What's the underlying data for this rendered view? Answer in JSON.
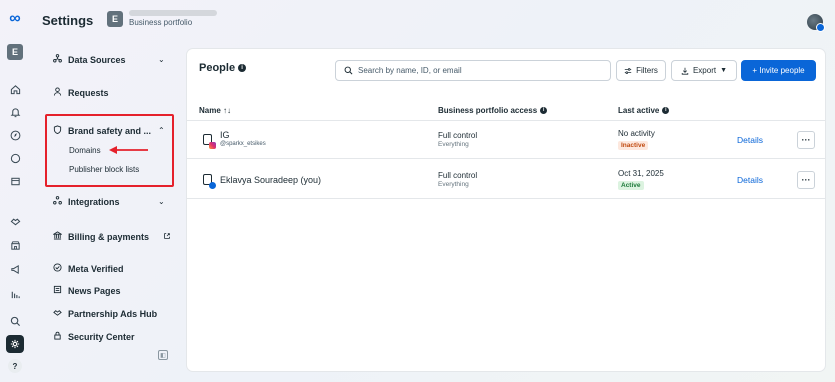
{
  "header": {
    "title": "Settings",
    "account_badge": "E",
    "account_subtitle": "Business portfolio"
  },
  "rail": {
    "e_badge": "E",
    "help": "?"
  },
  "sidebar": {
    "items": [
      {
        "label": "Data Sources",
        "icon": "data-sources-icon"
      },
      {
        "label": "Requests",
        "icon": "people-icon"
      },
      {
        "label": "Brand safety and ...",
        "icon": "shield-icon"
      },
      {
        "label": "Domains"
      },
      {
        "label": "Publisher block lists"
      },
      {
        "label": "Integrations",
        "icon": "integrations-icon"
      },
      {
        "label": "Billing & payments",
        "icon": "bank-icon"
      },
      {
        "label": "Meta Verified",
        "icon": "verified-icon"
      },
      {
        "label": "News Pages",
        "icon": "news-icon"
      },
      {
        "label": "Partnership Ads Hub",
        "icon": "handshake-icon"
      },
      {
        "label": "Security Center",
        "icon": "lock-icon"
      }
    ]
  },
  "people": {
    "title": "People",
    "search_placeholder": "Search by name, ID, or email",
    "filters_label": "Filters",
    "export_label": "Export",
    "invite_label": "+ Invite people",
    "columns": {
      "name": "Name ↑↓",
      "access": "Business portfolio access",
      "last_active": "Last active"
    },
    "rows": [
      {
        "name": "IG",
        "handle": "@sparkx_etsikes",
        "access": "Full control",
        "access_sub": "Everything",
        "last_active": "No activity",
        "status": "Inactive",
        "details": "Details"
      },
      {
        "name": "Eklavya Souradeep (you)",
        "handle": "",
        "access": "Full control",
        "access_sub": "Everything",
        "last_active": "Oct 31, 2025",
        "status": "Active",
        "details": "Details"
      }
    ]
  },
  "colors": {
    "accent": "#0a66d8",
    "highlight": "#e5212b",
    "inactive": "#c04a10",
    "active": "#1d7a3a"
  }
}
